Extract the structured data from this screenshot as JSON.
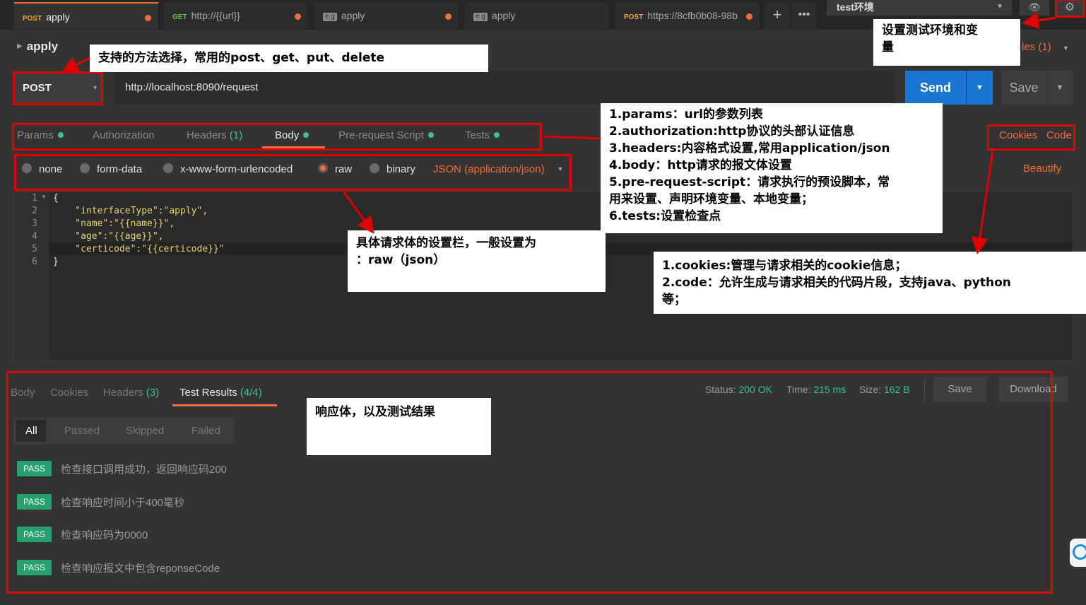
{
  "tabs": [
    {
      "method": "POST",
      "label": "apply",
      "active": true,
      "dirty": true
    },
    {
      "method": "GET",
      "label": "http://{{url}}",
      "active": false,
      "dirty": true
    },
    {
      "method": "e.g",
      "label": "apply",
      "active": false,
      "dirty": true
    },
    {
      "method": "e.g",
      "label": "apply",
      "active": false,
      "dirty": false
    },
    {
      "method": "POST",
      "label": "https://8cfb0b08-98b",
      "active": false,
      "dirty": true
    }
  ],
  "tabbar": {
    "add_icon": "plus-icon",
    "more_icon": "more-icon"
  },
  "environment": {
    "selected": "test环境",
    "eye_icon": "eye-icon",
    "gear_icon": "gear-icon"
  },
  "request": {
    "name": "apply",
    "examples_label": "les (1)",
    "method": "POST",
    "url": "http://localhost:8090/request",
    "send_label": "Send",
    "save_label": "Save"
  },
  "request_tabs": {
    "params": "Params",
    "authorization": "Authorization",
    "headers": "Headers",
    "headers_count": "(1)",
    "body": "Body",
    "pre_request": "Pre-request Script",
    "tests": "Tests",
    "cookies": "Cookies",
    "code": "Code"
  },
  "body_types": {
    "none": "none",
    "form_data": "form-data",
    "urlencoded": "x-www-form-urlencoded",
    "raw": "raw",
    "binary": "binary",
    "content_type": "JSON (application/json)",
    "beautify": "Beautify"
  },
  "editor": {
    "line_numbers": [
      "1",
      "2",
      "3",
      "4",
      "5",
      "6"
    ],
    "lines": [
      "{",
      "    \"interfaceType\":\"apply\",",
      "    \"name\":\"{{name}}\",",
      "    \"age\":\"{{age}}\",",
      "    \"certicode\":\"{{certicode}}\"",
      "}"
    ]
  },
  "response": {
    "tabs": {
      "body": "Body",
      "cookies": "Cookies",
      "headers": "Headers",
      "headers_count": "(3)",
      "test_results": "Test Results",
      "test_count": "(4/4)"
    },
    "status_label": "Status:",
    "status_value": "200 OK",
    "time_label": "Time:",
    "time_value": "215 ms",
    "size_label": "Size:",
    "size_value": "162 B",
    "save_label": "Save",
    "download_label": "Download",
    "filters": [
      "All",
      "Passed",
      "Skipped",
      "Failed"
    ],
    "results": [
      {
        "badge": "PASS",
        "text": "检查接口调用成功，返回响应码200"
      },
      {
        "badge": "PASS",
        "text": "检查响应时间小于400毫秒"
      },
      {
        "badge": "PASS",
        "text": "检查响应码为0000"
      },
      {
        "badge": "PASS",
        "text": "检查响应报文中包含reponseCode"
      }
    ]
  },
  "annotations": {
    "env": "设置测试环境和变\n量",
    "method": "支持的方法选择，常用的post、get、put、delete",
    "tabs": "1.params：url的参数列表\n2.authorization:http协议的头部认证信息\n3.headers:内容格式设置,常用application/json\n4.body：http请求的报文体设置\n5.pre-request-script：请求执行的预设脚本，常\n用来设置、声明环境变量、本地变量；\n6.tests:设置检查点",
    "body": "具体请求体的设置栏，一般设置为\n：raw（json）",
    "cookies": "1.cookies:管理与请求相关的cookie信息；\n2.code：允许生成与请求相关的代码片段，支持java、python\n等；",
    "response": "响应体，以及测试结果"
  },
  "colors": {
    "accent": "#f26b3a",
    "send": "#1976d2",
    "success": "#3ac38a",
    "annotation": "#e00000"
  }
}
